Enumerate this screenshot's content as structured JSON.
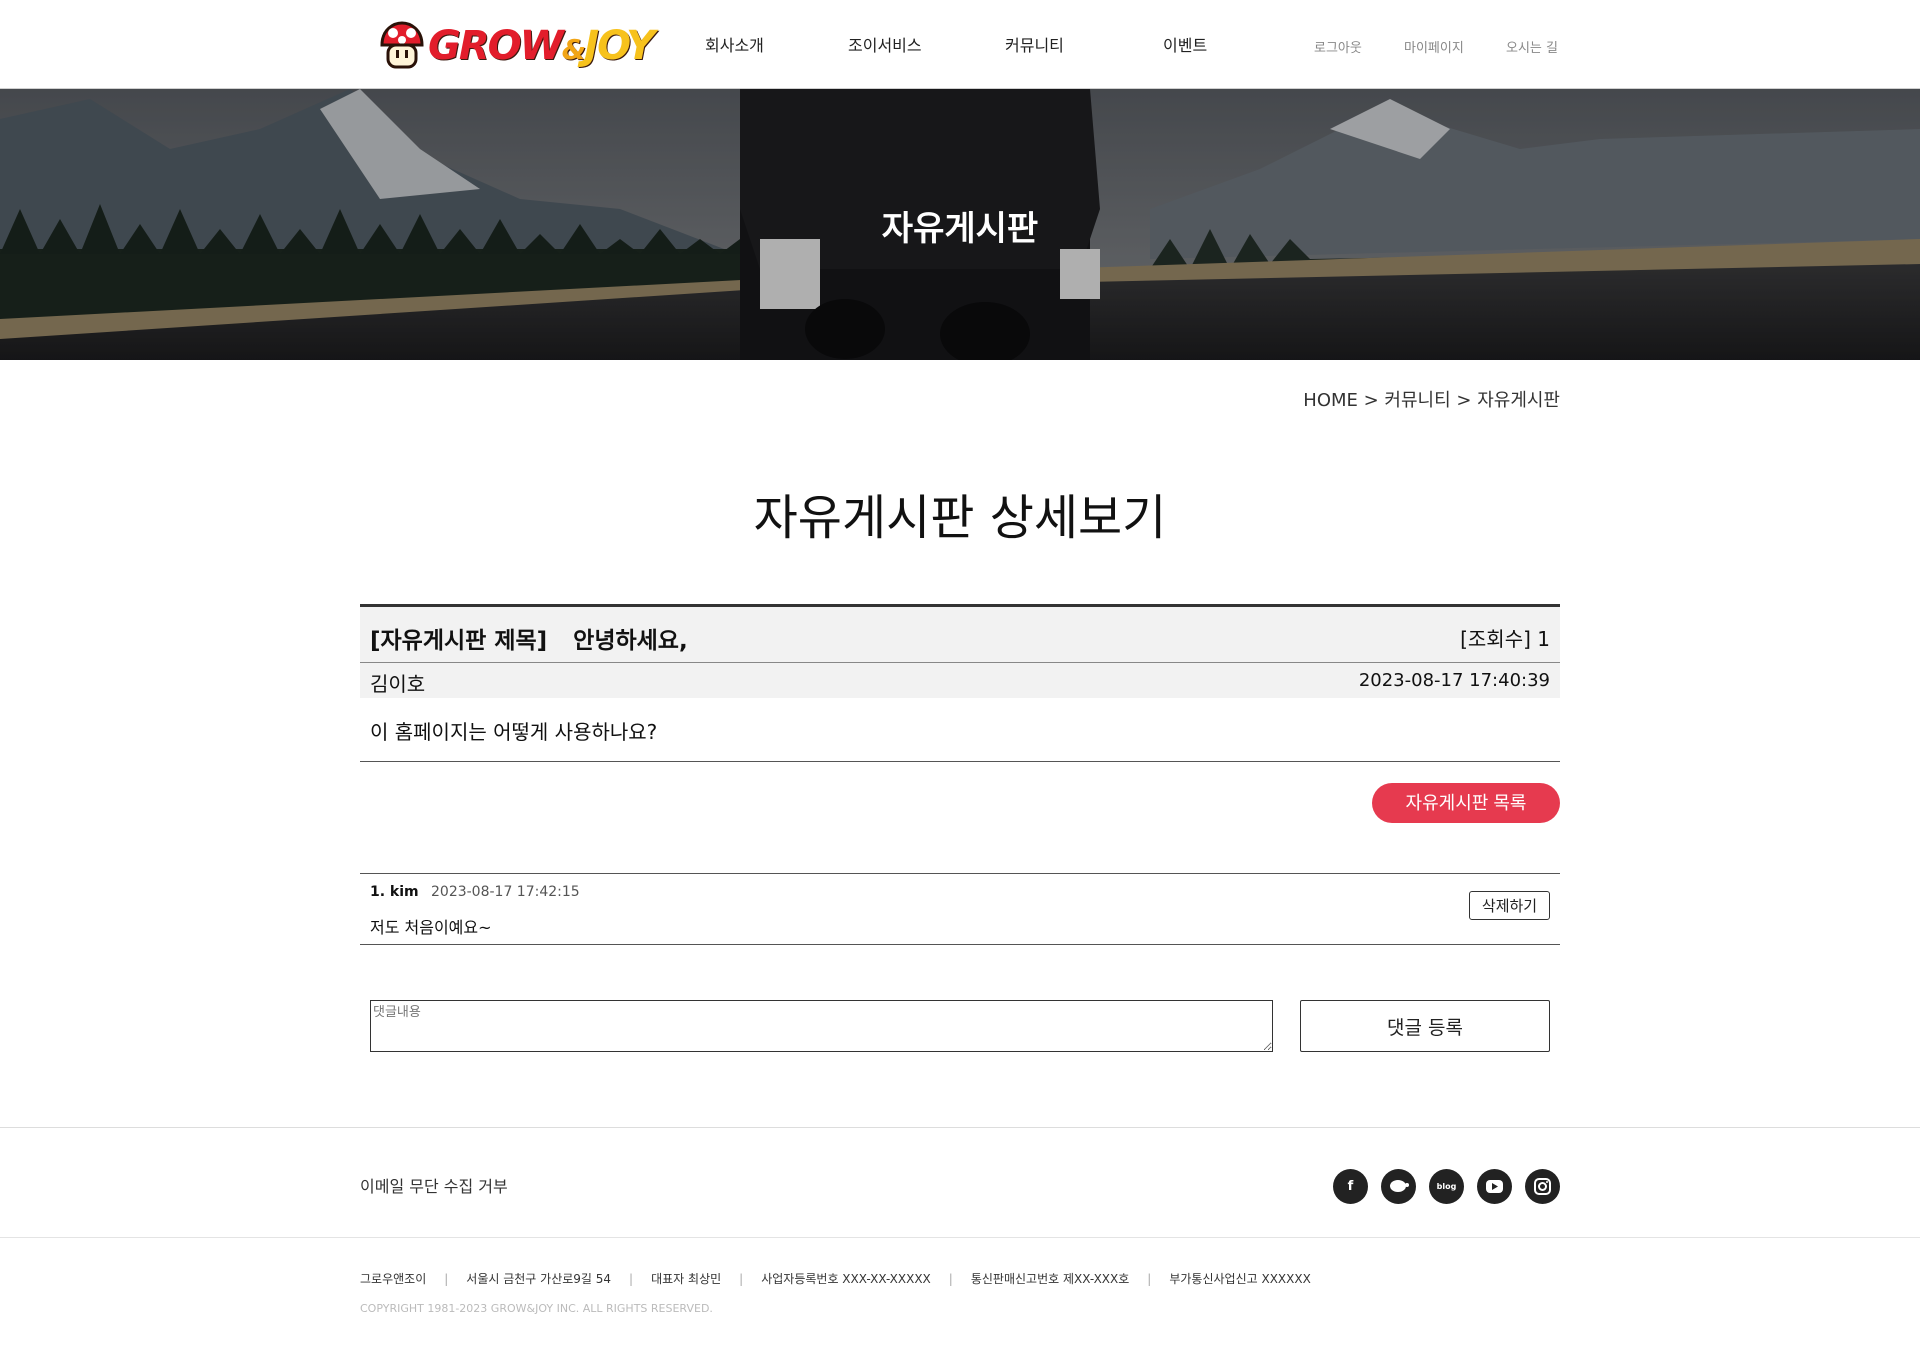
{
  "header": {
    "logo_text": {
      "grow": "GROW",
      "amp": "&",
      "joy": "JOY"
    },
    "nav": [
      "회사소개",
      "조이서비스",
      "커뮤니티",
      "이벤트"
    ],
    "util": [
      "로그아웃",
      "마이페이지",
      "오시는 길"
    ]
  },
  "hero": {
    "title": "자유게시판"
  },
  "breadcrumb": "HOME > 커뮤니티 > 자유게시판",
  "page_title": "자유게시판 상세보기",
  "post": {
    "title_tag": "[자유게시판 제목]",
    "title": "안녕하세요,",
    "views": "[조회수] 1",
    "author": "김이호",
    "date": "2023-08-17 17:40:39",
    "body": "이 홈페이지는 어떻게 사용하나요?"
  },
  "list_button": "자유게시판 목록",
  "comments": [
    {
      "author": "1. kim",
      "date": "2023-08-17 17:42:15",
      "text": "저도 처음이예요~",
      "delete_label": "삭제하기"
    }
  ],
  "reply": {
    "placeholder": "댓글내용",
    "submit_label": "댓글 등록"
  },
  "footer": {
    "refuse": "이메일 무단 수집 거부",
    "sns": [
      "facebook-icon",
      "kakao-icon",
      "blog-icon",
      "youtube-icon",
      "instagram-icon"
    ],
    "blog_text": "blog",
    "info": [
      "그로우앤조이",
      "서울시 금천구 가산로9길 54",
      "대표자 최상민",
      "사업자등록번호 XXX-XX-XXXXX",
      "통신판매신고번호 제XX-XXX호",
      "부가통신사업신고 XXXXXX"
    ],
    "copyright": "COPYRIGHT 1981-2023 GROW&JOY INC. ALL RIGHTS RESERVED."
  },
  "colors": {
    "accent": "#e63a4f",
    "logo_red": "#e21d2b",
    "logo_yellow": "#f7c21c"
  }
}
